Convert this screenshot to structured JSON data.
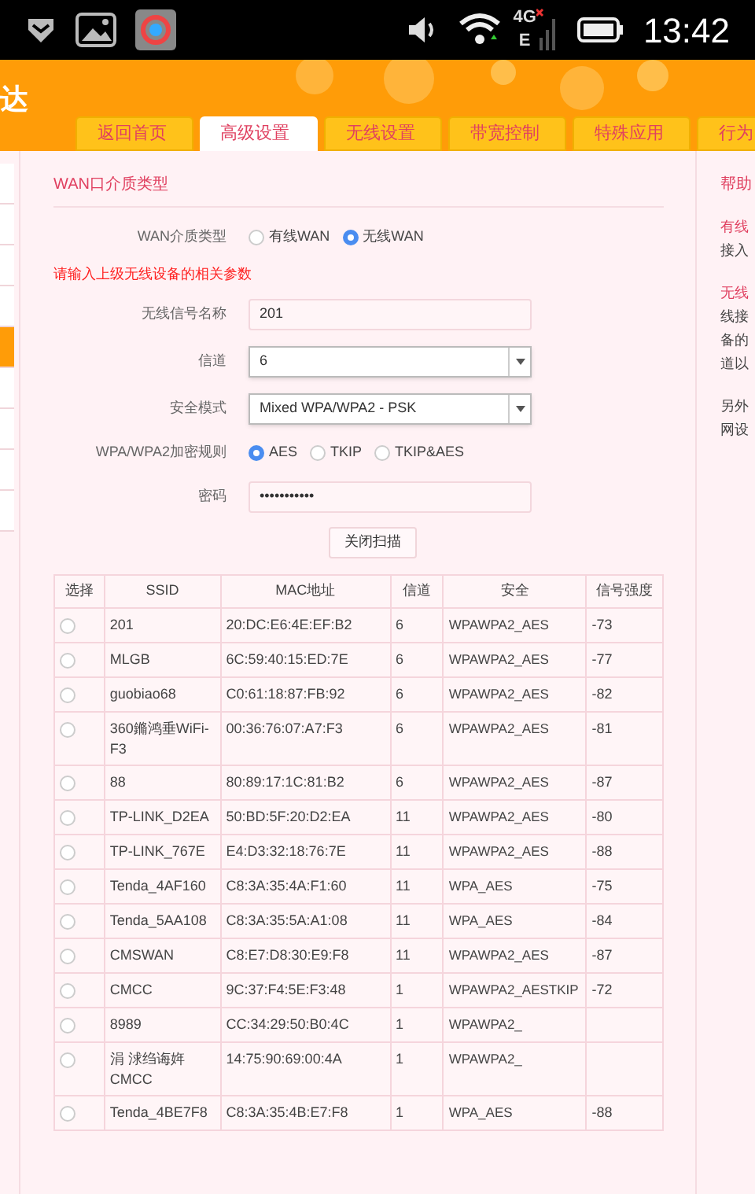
{
  "status_bar": {
    "network_labels": [
      "4G",
      "E"
    ],
    "time": "13:42"
  },
  "header": {
    "title": "达",
    "tabs": [
      {
        "label": "返回首页",
        "selected": false
      },
      {
        "label": "高级设置",
        "selected": true
      },
      {
        "label": "无线设置",
        "selected": false
      },
      {
        "label": "带宽控制",
        "selected": false
      },
      {
        "label": "特殊应用",
        "selected": false
      },
      {
        "label": "行为",
        "selected": false
      }
    ]
  },
  "sidebar": {
    "items": [
      {
        "selected": false
      },
      {
        "selected": false
      },
      {
        "selected": false
      },
      {
        "selected": false
      },
      {
        "selected": true
      },
      {
        "selected": false
      },
      {
        "selected": false
      },
      {
        "selected": false
      },
      {
        "selected": false
      }
    ]
  },
  "form": {
    "title": "WAN口介质类型",
    "fields": [
      {
        "kind": "radio",
        "label": "WAN介质类型",
        "options": [
          {
            "label": "有线WAN",
            "selected": false
          },
          {
            "label": "无线WAN",
            "selected": true
          }
        ]
      },
      {
        "kind": "notice",
        "label": "请输入上级无线设备的相关参数"
      },
      {
        "kind": "text",
        "label": "无线信号名称",
        "value": "201"
      },
      {
        "kind": "select",
        "label": "信道",
        "value": "6"
      },
      {
        "kind": "select",
        "label": "安全模式",
        "value": "Mixed WPA/WPA2 - PSK"
      },
      {
        "kind": "radio",
        "label": "WPA/WPA2加密规则",
        "options": [
          {
            "label": "AES",
            "selected": true
          },
          {
            "label": "TKIP",
            "selected": false
          },
          {
            "label": "TKIP&AES",
            "selected": false
          }
        ]
      },
      {
        "kind": "text",
        "label": "密码",
        "value": "•••••••••••"
      }
    ],
    "button": "关闭扫描"
  },
  "table": {
    "columns": [
      "选择",
      "SSID",
      "MAC地址",
      "信道",
      "安全",
      "信号强度"
    ],
    "rows": [
      {
        "selected": false,
        "ssid": "201",
        "mac": "20:DC:E6:4E:EF:B2",
        "channel": "6",
        "security": "WPAWPA2_AES",
        "signal": "-73"
      },
      {
        "selected": false,
        "ssid": "MLGB",
        "mac": "6C:59:40:15:ED:7E",
        "channel": "6",
        "security": "WPAWPA2_AES",
        "signal": "-77"
      },
      {
        "selected": false,
        "ssid": "guobiao68",
        "mac": "C0:61:18:87:FB:92",
        "channel": "6",
        "security": "WPAWPA2_AES",
        "signal": "-82"
      },
      {
        "selected": false,
        "ssid": "360鏅鸿垂WiFi-F3",
        "mac": "00:36:76:07:A7:F3",
        "channel": "6",
        "security": "WPAWPA2_AES",
        "signal": "-81"
      },
      {
        "selected": false,
        "ssid": "88",
        "mac": "80:89:17:1C:81:B2",
        "channel": "6",
        "security": "WPAWPA2_AES",
        "signal": "-87"
      },
      {
        "selected": false,
        "ssid": "TP-LINK_D2EA",
        "mac": "50:BD:5F:20:D2:EA",
        "channel": "11",
        "security": "WPAWPA2_AES",
        "signal": "-80"
      },
      {
        "selected": false,
        "ssid": "TP-LINK_767E",
        "mac": "E4:D3:32:18:76:7E",
        "channel": "11",
        "security": "WPAWPA2_AES",
        "signal": "-88"
      },
      {
        "selected": false,
        "ssid": "Tenda_4AF160",
        "mac": "C8:3A:35:4A:F1:60",
        "channel": "11",
        "security": "WPA_AES",
        "signal": "-75"
      },
      {
        "selected": false,
        "ssid": "Tenda_5AA108",
        "mac": "C8:3A:35:5A:A1:08",
        "channel": "11",
        "security": "WPA_AES",
        "signal": "-84"
      },
      {
        "selected": false,
        "ssid": "CMSWAN",
        "mac": "C8:E7:D8:30:E9:F8",
        "channel": "11",
        "security": "WPAWPA2_AES",
        "signal": "-87"
      },
      {
        "selected": false,
        "ssid": "CMCC",
        "mac": "9C:37:F4:5E:F3:48",
        "channel": "1",
        "security": "WPAWPA2_AESTKIP",
        "signal": "-72"
      },
      {
        "selected": false,
        "ssid": "8989",
        "mac": "CC:34:29:50:B0:4C",
        "channel": "1",
        "security": "WPAWPA2_"
      },
      {
        "selected": false,
        "ssid": "涓 浗绉诲姩 CMCC",
        "mac": "14:75:90:69:00:4A",
        "channel": "1",
        "security": "WPAWPA2_"
      },
      {
        "selected": false,
        "ssid": "Tenda_4BE7F8",
        "mac": "C8:3A:35:4B:E7:F8",
        "channel": "1",
        "security": "WPA_AES",
        "signal": "-88"
      }
    ]
  },
  "help": {
    "title": "帮助",
    "sections": [
      {
        "heading": "有线",
        "lines": [
          "接入"
        ]
      },
      {
        "heading": "无线",
        "lines": [
          "线接",
          "备的",
          "道以"
        ]
      },
      {
        "lines": [
          "另外",
          "网设"
        ]
      }
    ]
  }
}
